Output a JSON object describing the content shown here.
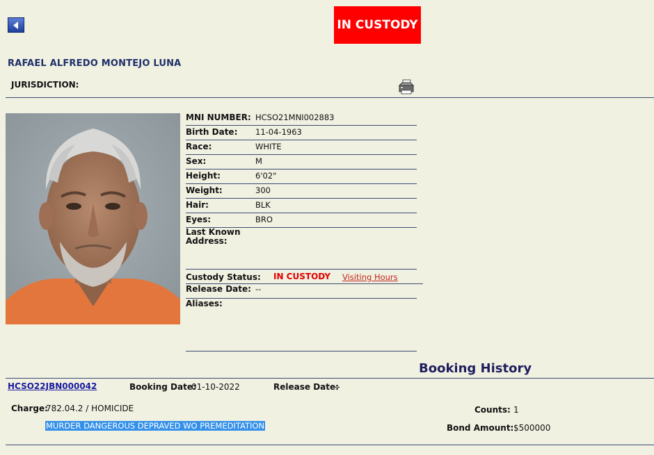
{
  "header": {
    "custody_banner": "IN CUSTODY",
    "inmate_name": "RAFAEL ALFREDO MONTEJO LUNA",
    "jurisdiction_label": "JURISDICTION:",
    "jurisdiction_value": ""
  },
  "icons": {
    "back": "back-arrow-icon",
    "print": "printer-icon"
  },
  "colors": {
    "background": "#f1f1e2",
    "banner": "#fe0000",
    "name": "#1e2f68",
    "status": "#e00000"
  },
  "details": {
    "mni_label": "MNI NUMBER:",
    "mni_value": "HCSO21MNI002883",
    "birth_label": "Birth Date:",
    "birth_value": "11-04-1963",
    "race_label": "Race:",
    "race_value": "WHITE",
    "sex_label": "Sex:",
    "sex_value": "M",
    "height_label": "Height:",
    "height_value": "6'02\"",
    "weight_label": "Weight:",
    "weight_value": "300",
    "hair_label": "Hair:",
    "hair_value": "BLK",
    "eyes_label": "Eyes:",
    "eyes_value": "BRO",
    "address_label_1": "Last Known",
    "address_label_2": "Address:",
    "address_value": "",
    "custody_status_label": "Custody Status:",
    "custody_status_value": "IN CUSTODY",
    "visiting_hours_link": "Visiting Hours",
    "release_label": "Release Date:",
    "release_value": "--",
    "aliases_label": "Aliases:",
    "aliases_value": ""
  },
  "booking_history": {
    "title": "Booking History",
    "booking_number": "HCSO22JBN000042",
    "booking_date_label": "Booking Date:",
    "booking_date_value": "01-10-2022",
    "release_date_label": "Release Date:",
    "release_date_value": "--",
    "charge_label": "Charge:",
    "charge_value": "782.04.2 / HOMICIDE",
    "description": "MURDER DANGEROUS DEPRAVED WO PREMEDITATION",
    "counts_label": "Counts:",
    "counts_value": "1",
    "bond_label": "Bond Amount:",
    "bond_value": "$500000"
  }
}
